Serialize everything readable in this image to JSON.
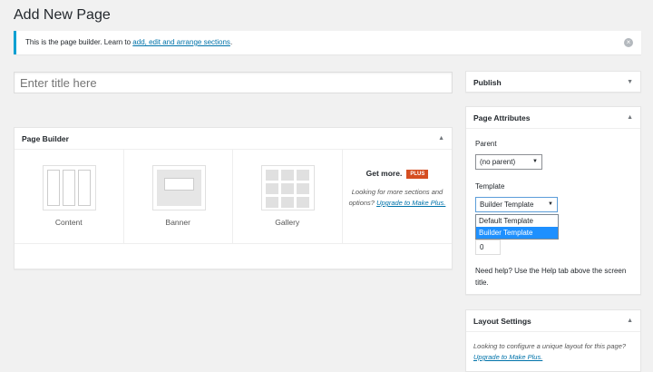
{
  "page": {
    "title": "Add New Page"
  },
  "notice": {
    "text": "This is the page builder. Learn to ",
    "link": "add, edit and arrange sections",
    "after": "."
  },
  "title_input": {
    "placeholder": "Enter title here"
  },
  "page_builder": {
    "header": "Page Builder",
    "sections": [
      {
        "label": "Content",
        "icon": "content-columns-icon"
      },
      {
        "label": "Banner",
        "icon": "banner-icon"
      },
      {
        "label": "Gallery",
        "icon": "gallery-grid-icon"
      }
    ],
    "get_more": {
      "title": "Get more.",
      "badge": "PLUS",
      "text": "Looking for more sections and options? ",
      "link": "Upgrade to Make Plus."
    }
  },
  "publish": {
    "header": "Publish"
  },
  "page_attributes": {
    "header": "Page Attributes",
    "parent_label": "Parent",
    "parent_value": "(no parent)",
    "template_label": "Template",
    "template_value": "Builder Template",
    "template_options": [
      "Default Template",
      "Builder Template"
    ],
    "order_value": "0",
    "help": "Need help? Use the Help tab above the screen title."
  },
  "layout_settings": {
    "header": "Layout Settings",
    "text": "Looking to configure a unique layout for this page? ",
    "link": "Upgrade to Make Plus."
  },
  "colors": {
    "accent": "#00a0d2",
    "link": "#0073aa",
    "plus_badge": "#d54e21",
    "selected_option": "#1e90ff"
  }
}
